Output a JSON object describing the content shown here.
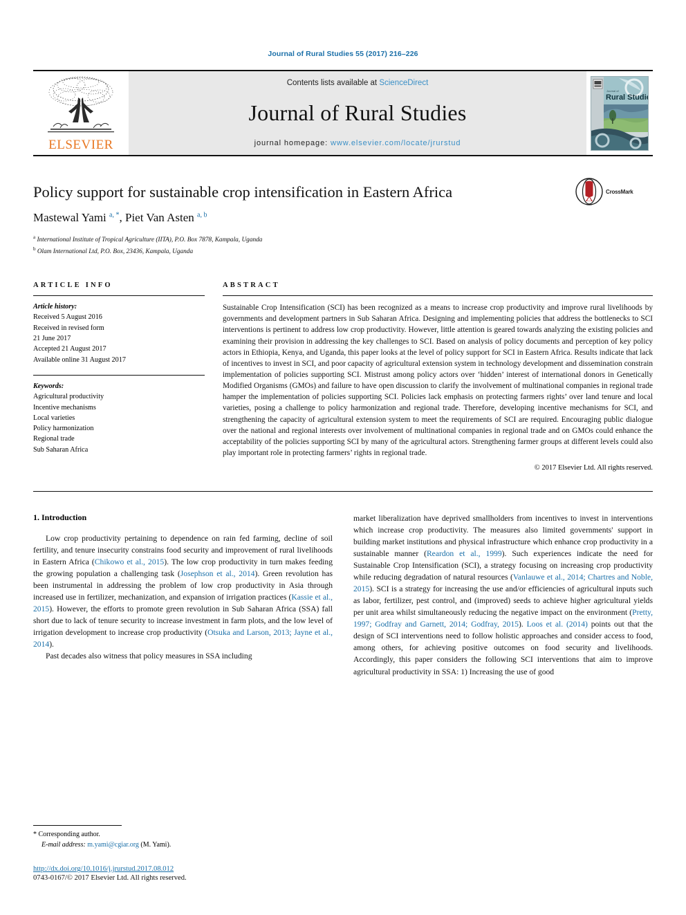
{
  "running_head": "Journal of Rural Studies 55 (2017) 216–226",
  "masthead": {
    "publisher": "ELSEVIER",
    "contents_prefix": "Contents lists available at ",
    "contents_link": "ScienceDirect",
    "journal_name": "Journal of Rural Studies",
    "homepage_prefix": "journal homepage: ",
    "homepage_url": "www.elsevier.com/locate/jrurstud",
    "cover_title": "Rural Studies",
    "cover_kicker": "Journal of"
  },
  "article": {
    "title": "Policy support for sustainable crop intensification in Eastern Africa",
    "authors_html": "Mastewal Yami <sup>a, *</sup>, Piet Van Asten <sup>a, b</sup>",
    "affiliation_a": "International Institute of Tropical Agriculture (IITA), P.O. Box 7878, Kampala, Uganda",
    "affiliation_b": "Olam International Ltd, P.O. Box, 23436, Kampala, Uganda",
    "crossmark_label": "CrossMark"
  },
  "article_info": {
    "heading": "ARTICLE INFO",
    "history_label": "Article history:",
    "history": [
      "Received 5 August 2016",
      "Received in revised form",
      "21 June 2017",
      "Accepted 21 August 2017",
      "Available online 31 August 2017"
    ],
    "keywords_label": "Keywords:",
    "keywords": [
      "Agricultural productivity",
      "Incentive mechanisms",
      "Local varieties",
      "Policy harmonization",
      "Regional trade",
      "Sub Saharan Africa"
    ]
  },
  "abstract": {
    "heading": "ABSTRACT",
    "text": "Sustainable Crop Intensification (SCI) has been recognized as a means to increase crop productivity and improve rural livelihoods by governments and development partners in Sub Saharan Africa. Designing and implementing policies that address the bottlenecks to SCI interventions is pertinent to address low crop productivity. However, little attention is geared towards analyzing the existing policies and examining their provision in addressing the key challenges to SCI. Based on analysis of policy documents and perception of key policy actors in Ethiopia, Kenya, and Uganda, this paper looks at the level of policy support for SCI in Eastern Africa. Results indicate that lack of incentives to invest in SCI, and poor capacity of agricultural extension system in technology development and dissemination constrain implementation of policies supporting SCI. Mistrust among policy actors over ‘hidden’ interest of international donors in Genetically Modified Organisms (GMOs) and failure to have open discussion to clarify the involvement of multinational companies in regional trade hamper the implementation of policies supporting SCI. Policies lack emphasis on protecting farmers rights’ over land tenure and local varieties, posing a challenge to policy harmonization and regional trade. Therefore, developing incentive mechanisms for SCI, and strengthening the capacity of agricultural extension system to meet the requirements of SCI are required. Encouraging public dialogue over the national and regional interests over involvement of multinational companies in regional trade and on GMOs could enhance the acceptability of the policies supporting SCI by many of the agricultural actors. Strengthening farmer groups at different levels could also play important role in protecting farmers’ rights in regional trade.",
    "copyright": "© 2017 Elsevier Ltd. All rights reserved."
  },
  "body": {
    "section_number_title": "1. Introduction",
    "left_paragraphs_html": [
      "Low crop productivity pertaining to dependence on rain fed farming, decline of soil fertility, and tenure insecurity constrains food security and improvement of rural livelihoods in Eastern Africa (<span class=\"ref\">Chikowo et al., 2015</span>). The low crop productivity in turn makes feeding the growing population a challenging task (<span class=\"ref\">Josephson et al., 2014</span>). Green revolution has been instrumental in addressing the problem of low crop productivity in Asia through increased use in fertilizer, mechanization, and expansion of irrigation practices (<span class=\"ref\">Kassie et al., 2015</span>). However, the efforts to promote green revolution in Sub Saharan Africa (SSA) fall short due to lack of tenure security to increase investment in farm plots, and the low level of irrigation development to increase crop productivity (<span class=\"ref\">Otsuka and Larson, 2013; Jayne et al., 2014</span>).",
      "Past decades also witness that policy measures in SSA including"
    ],
    "right_paragraphs_html": [
      "market liberalization have deprived smallholders from incentives to invest in interventions which increase crop productivity. The measures also limited governments' support in building market institutions and physical infrastructure which enhance crop productivity in a sustainable manner (<span class=\"ref\">Reardon et al., 1999</span>). Such experiences indicate the need for Sustainable Crop Intensification (SCI), a strategy focusing on increasing crop productivity while reducing degradation of natural resources (<span class=\"ref\">Vanlauwe et al., 2014; Chartres and Noble, 2015</span>). SCI is a strategy for increasing the use and/or efficiencies of agricultural inputs such as labor, fertilizer, pest control, and (improved) seeds to achieve higher agricultural yields per unit area whilst simultaneously reducing the negative impact on the environment (<span class=\"ref\">Pretty, 1997; Godfray and Garnett, 2014; Godfray, 2015</span>). <span class=\"ref\">Loos et al. (2014)</span> points out that the design of SCI interventions need to follow holistic approaches and consider access to food, among others, for achieving positive outcomes on food security and livelihoods. Accordingly, this paper considers the following SCI interventions that aim to improve agricultural productivity in SSA: 1) Increasing the use of good"
    ]
  },
  "footer": {
    "corresponding_author": "Corresponding author.",
    "email_label": "E-mail address:",
    "email": "m.yami@cgiar.org",
    "email_suffix": "(M. Yami).",
    "doi": "http://dx.doi.org/10.1016/j.jrurstud.2017.08.012",
    "issn_line": "0743-0167/© 2017 Elsevier Ltd. All rights reserved."
  },
  "colors": {
    "link_blue": "#1a6fa8",
    "elsevier_orange": "#E87722",
    "masthead_gray": "#e8e8e8"
  }
}
